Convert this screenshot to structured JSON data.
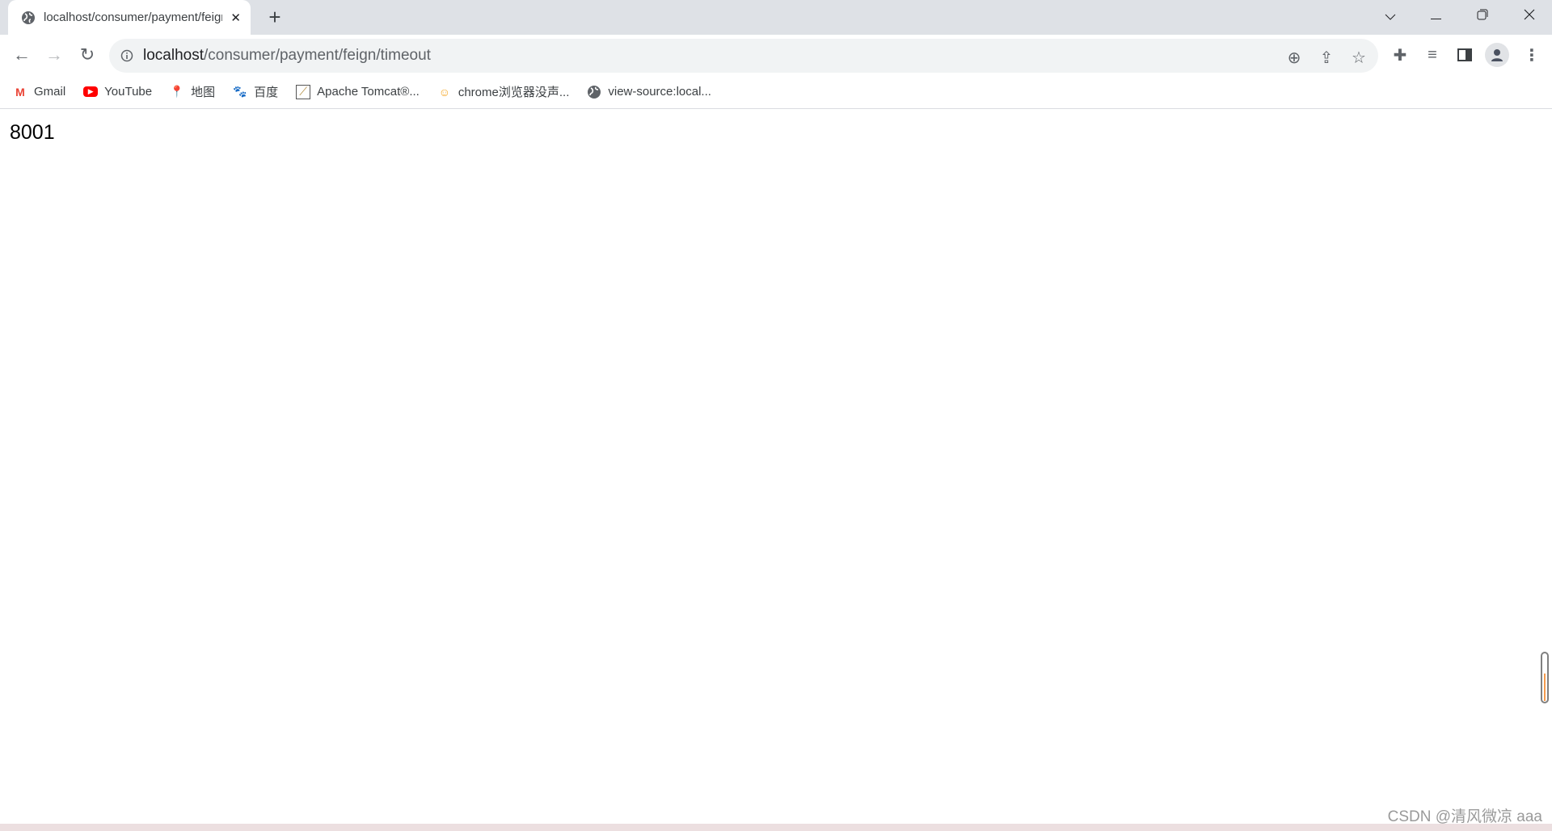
{
  "tab": {
    "title": "localhost/consumer/payment/feign/timeout",
    "icon": "globe-icon",
    "close": "✕"
  },
  "new_tab": "+",
  "window": {
    "tab_search": "⌄",
    "minimize": "—",
    "restore": "❐",
    "close": "✕"
  },
  "address": {
    "host": "localhost",
    "path": "/consumer/payment/feign/timeout"
  },
  "bookmarks": [
    {
      "label": "Gmail",
      "icon": "gmail-icon",
      "color": "#ea4335"
    },
    {
      "label": "YouTube",
      "icon": "youtube-icon",
      "color": "#ff0000"
    },
    {
      "label": "地图",
      "icon": "maps-icon",
      "color": "#34a853"
    },
    {
      "label": "百度",
      "icon": "baidu-icon",
      "color": "#2932e1"
    },
    {
      "label": "Apache Tomcat®...",
      "icon": "tomcat-icon",
      "color": "#b08a3c"
    },
    {
      "label": "chrome浏览器没声...",
      "icon": "smiley-icon",
      "color": "#f5a623"
    },
    {
      "label": "view-source:local...",
      "icon": "globe-icon",
      "color": "#5f6368"
    }
  ],
  "page": {
    "text": "8001"
  },
  "watermark": "CSDN @清风微凉 aaa"
}
